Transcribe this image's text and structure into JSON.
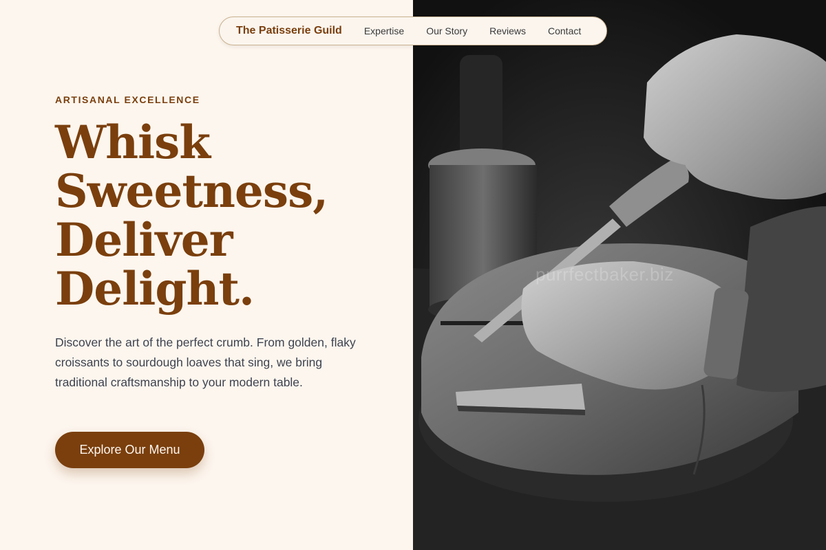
{
  "nav": {
    "brand": "The Patisserie Guild",
    "links": [
      "Expertise",
      "Our Story",
      "Reviews",
      "Contact"
    ]
  },
  "hero": {
    "eyebrow": "ARTISANAL EXCELLENCE",
    "headline_lines": [
      "Whisk",
      "Sweetness,",
      "Deliver",
      "Delight."
    ],
    "description": "Discover the art of the perfect crumb. From golden, flaky croissants to sourdough loaves that sing, we bring traditional craftsmanship to your modern table.",
    "cta_label": "Explore Our Menu"
  },
  "photo": {
    "watermark": "purrfectbaker.biz"
  },
  "colors": {
    "brand_brown": "#7a3f0d",
    "page_background": "#fdf6ee",
    "body_text": "#3e4350",
    "photo_background": "#151515"
  }
}
